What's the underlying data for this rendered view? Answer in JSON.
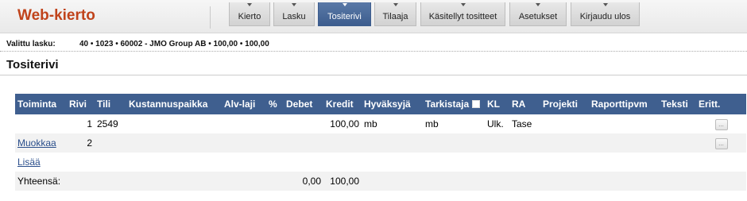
{
  "app": {
    "title": "Web-kierto"
  },
  "nav": [
    {
      "label": "Kierto",
      "active": false
    },
    {
      "label": "Lasku",
      "active": false
    },
    {
      "label": "Tositerivi",
      "active": true
    },
    {
      "label": "Tilaaja",
      "active": false
    },
    {
      "label": "Käsitellyt tositteet",
      "active": false
    },
    {
      "label": "Asetukset",
      "active": false
    },
    {
      "label": "Kirjaudu ulos",
      "active": false
    }
  ],
  "selected_invoice": {
    "label": "Valittu lasku:",
    "value": "40 • 1023 • 60002 - JMO Group AB • 100,00 • 100,00"
  },
  "page": {
    "title": "Tositerivi"
  },
  "table": {
    "headers": {
      "toiminta": "Toiminta",
      "rivi": "Rivi",
      "tili": "Tili",
      "kustannuspaikka": "Kustannuspaikka",
      "alv_laji": "Alv-laji",
      "pct": "%",
      "debet": "Debet",
      "kredit": "Kredit",
      "hyvaksyja": "Hyväksyjä",
      "tarkistaja": "Tarkistaja",
      "kl": "KL",
      "ra": "RA",
      "projekti": "Projekti",
      "raporttipvm": "Raporttipvm",
      "teksti": "Teksti",
      "eritt": "Eritt."
    },
    "rows": [
      {
        "action": "",
        "rivi": "1",
        "tili": "2549",
        "debet": "",
        "kredit": "100,00",
        "hyvaksyja": "mb",
        "tarkistaja": "mb",
        "kl": "Ulk.",
        "ra": "Tase",
        "eritt": "..."
      },
      {
        "action": "Muokkaa",
        "rivi": "2",
        "tili": "",
        "debet": "",
        "kredit": "",
        "hyvaksyja": "",
        "tarkistaja": "",
        "kl": "",
        "ra": "",
        "eritt": "..."
      }
    ],
    "add_label": "Lisää",
    "total": {
      "label": "Yhteensä:",
      "debet": "0,00",
      "kredit": "100,00"
    }
  },
  "colors": {
    "brand": "#c0431b",
    "accent": "#3f5f8f",
    "link": "#2b4f8c"
  }
}
